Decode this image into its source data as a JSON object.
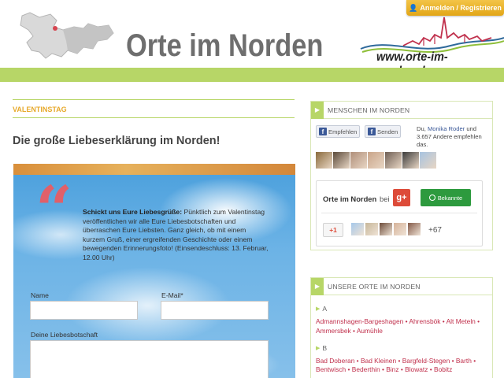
{
  "header": {
    "site_title": "Orte im Norden",
    "site_url": "www.orte-im-norden.de",
    "login_label": "Anmelden / Registrieren",
    "band_color": "#b7d667",
    "accent_orange": "#e7a92b"
  },
  "article": {
    "section_label": "VALENTINSTAG",
    "title": "Die große Liebeserklärung im Norden!",
    "intro_bold": "Schickt uns Eure Liebesgrüße:",
    "intro_text": " Pünktlich zum Valentinstag veröffentlichen wir alle Eure Liebesbotschaften und überraschen Eure Liebsten. Ganz gleich, ob mit einem kurzem Gruß, einer ergreifenden Geschichte oder einem bewegenden Erinnerungsfoto! (Einsendeschluss: 13. Februar, 12.00 Uhr)",
    "form": {
      "name_label": "Name",
      "email_label": "E-Mail*",
      "message_label": "Deine Liebesbotschaft",
      "name_value": "",
      "email_value": "",
      "message_value": ""
    }
  },
  "sidebar": {
    "people_box": {
      "heading": "MENSCHEN IM NORDEN",
      "recommend_label": "Empfehlen",
      "send_label": "Senden",
      "social_prefix": "Du, ",
      "social_name": "Monika Roder",
      "social_suffix": " und 3.657 Andere empfehlen das.",
      "avatar_colors": [
        "#8a6a3c",
        "#5b4a3a",
        "#b08f7a",
        "#c9a58a",
        "#6f5f55",
        "#3a3a3a",
        "#a7c3e0"
      ],
      "gplus": {
        "name": "Orte im Norden",
        "bei": "bei",
        "logo": "g+",
        "follow_label": "Bekannte",
        "plusone_label": "+1",
        "avatar_colors": [
          "#a6c8ea",
          "#c7b79a",
          "#6e4c3a",
          "#d6b39a",
          "#845a48"
        ],
        "count": "+67"
      }
    },
    "places_box": {
      "heading": "UNSERE ORTE IM NORDEN",
      "groups": [
        {
          "letter": "A",
          "places": [
            "Admannshagen-Bargeshagen",
            "Ahrensbök",
            "Alt Meteln",
            "Ammersbek",
            "Aumühle"
          ]
        },
        {
          "letter": "B",
          "places": [
            "Bad Doberan",
            "Bad Kleinen",
            "Bargfeld-Stegen",
            "Barth",
            "Bentwisch",
            "Bederthin",
            "Binz",
            "Blowatz",
            "Bobitz"
          ]
        }
      ]
    }
  }
}
